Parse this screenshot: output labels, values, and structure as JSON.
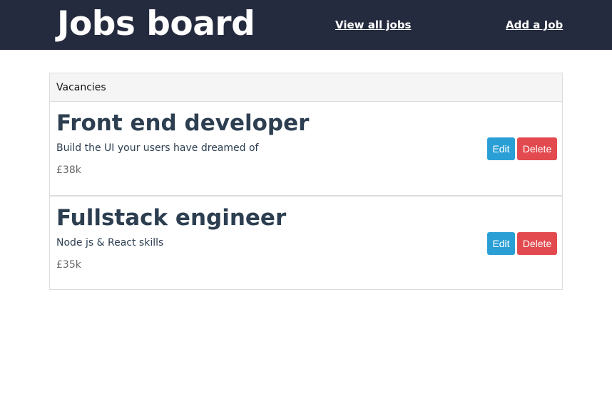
{
  "header": {
    "brand": "Jobs board",
    "nav": {
      "view_all": "View all jobs",
      "add_job": "Add a Job"
    }
  },
  "panel": {
    "heading": "Vacancies",
    "jobs": [
      {
        "title": "Front end developer",
        "description": "Build the UI your users have dreamed of",
        "salary": "£38k",
        "edit_label": "Edit",
        "delete_label": "Delete"
      },
      {
        "title": "Fullstack engineer",
        "description": "Node js & React skills",
        "salary": "£35k",
        "edit_label": "Edit",
        "delete_label": "Delete"
      }
    ]
  },
  "colors": {
    "navbar": "#252b3e",
    "edit": "#2a9fd6",
    "delete": "#e24a4f"
  }
}
